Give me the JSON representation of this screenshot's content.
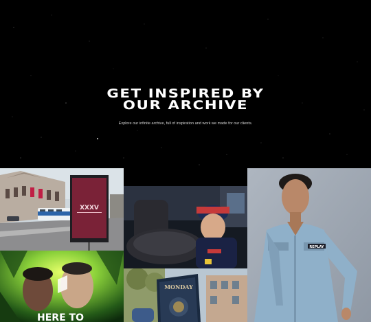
{
  "hero": {
    "title_line1": "GET INSPIRED BY",
    "title_line2": "OUR ARCHIVE",
    "subtitle": "Explore our infinite archive, full of inspiration and work we made for our clients."
  },
  "tiles": [
    {
      "name": "tile-amsterdam-tram",
      "sign_text": "XXXV"
    },
    {
      "name": "tile-racing-driver"
    },
    {
      "name": "tile-replay-model",
      "badge_text": "REPLAY"
    },
    {
      "name": "tile-jungle-portrait",
      "headline": "HERE TO"
    },
    {
      "name": "tile-street-poster",
      "poster_text": "MONDAY"
    }
  ]
}
